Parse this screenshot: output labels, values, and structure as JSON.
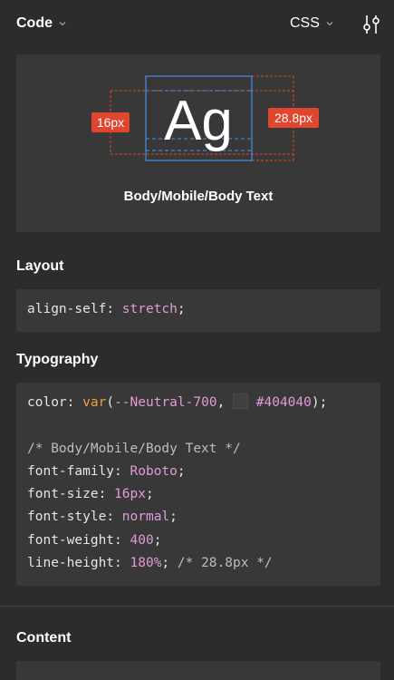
{
  "header": {
    "title": "Code",
    "language": "CSS"
  },
  "preview": {
    "sample_text": "Ag",
    "left_badge": "16px",
    "right_badge": "28.8px",
    "style_name": "Body/Mobile/Body Text",
    "badge_color": "#e0452e",
    "guide_color": "#4a90e2"
  },
  "layout": {
    "title": "Layout",
    "prop": "align-self",
    "value": "stretch"
  },
  "typography": {
    "title": "Typography",
    "color_prop": "color",
    "color_fn": "var",
    "color_var": "--Neutral-700",
    "color_hex": "#404040",
    "comment": "/* Body/Mobile/Body Text */",
    "lines": [
      {
        "prop": "font-family",
        "value": "Roboto"
      },
      {
        "prop": "font-size",
        "value": "16px"
      },
      {
        "prop": "font-style",
        "value": "normal"
      },
      {
        "prop": "font-weight",
        "value": "400"
      },
      {
        "prop": "line-height",
        "value": "180%"
      }
    ],
    "line_height_comment": "/* 28.8px */"
  },
  "content": {
    "title": "Content"
  }
}
